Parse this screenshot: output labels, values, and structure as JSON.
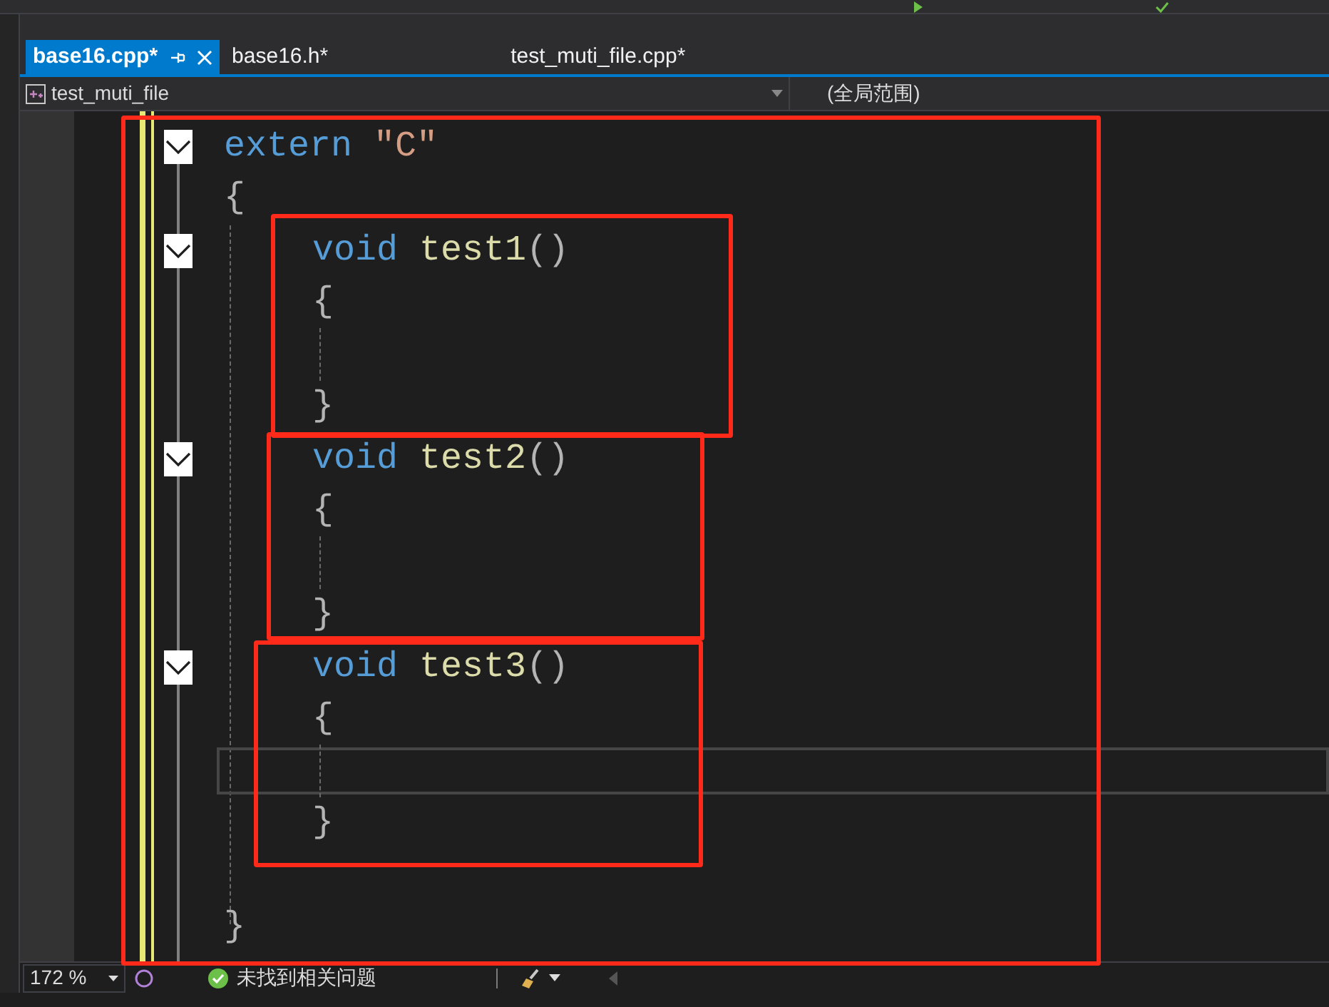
{
  "tabs": [
    {
      "label": "base16.cpp*",
      "selected": true,
      "pinned": true
    },
    {
      "label": "base16.h*",
      "selected": false,
      "pinned": false
    },
    {
      "label": "test_muti_file.cpp*",
      "selected": false,
      "pinned": false
    }
  ],
  "nav_bar": {
    "scope": "test_muti_file",
    "member": "(全局范围)"
  },
  "code_lines": [
    {
      "indented": false,
      "foldable": true,
      "current": false,
      "tokens": [
        {
          "kind": "keyword",
          "text": "extern"
        },
        {
          "kind": "string",
          "text": "\"C\""
        }
      ]
    },
    {
      "indented": false,
      "foldable": false,
      "current": false,
      "tokens": [
        {
          "kind": "punct",
          "text": "{"
        }
      ]
    },
    {
      "indented": true,
      "foldable": true,
      "current": false,
      "tokens": [
        {
          "kind": "keyword",
          "text": "void"
        },
        {
          "kind": "function",
          "text": "test1"
        },
        {
          "kind": "punct",
          "text": "()"
        }
      ]
    },
    {
      "indented": true,
      "foldable": false,
      "current": false,
      "tokens": [
        {
          "kind": "punct",
          "text": "{"
        }
      ]
    },
    {
      "indented": true,
      "foldable": false,
      "current": false
    },
    {
      "indented": true,
      "foldable": false,
      "current": false,
      "tokens": [
        {
          "kind": "punct",
          "text": "}"
        }
      ]
    },
    {
      "indented": true,
      "foldable": true,
      "current": false,
      "tokens": [
        {
          "kind": "keyword",
          "text": "void"
        },
        {
          "kind": "function",
          "text": "test2"
        },
        {
          "kind": "punct",
          "text": "()"
        }
      ]
    },
    {
      "indented": true,
      "foldable": false,
      "current": false,
      "tokens": [
        {
          "kind": "punct",
          "text": "{"
        }
      ]
    },
    {
      "indented": true,
      "foldable": false,
      "current": false
    },
    {
      "indented": true,
      "foldable": false,
      "current": false,
      "tokens": [
        {
          "kind": "punct",
          "text": "}"
        }
      ]
    },
    {
      "indented": true,
      "foldable": true,
      "current": false,
      "tokens": [
        {
          "kind": "keyword",
          "text": "void"
        },
        {
          "kind": "function",
          "text": "test3"
        },
        {
          "kind": "punct",
          "text": "()"
        }
      ]
    },
    {
      "indented": true,
      "foldable": false,
      "current": false,
      "tokens": [
        {
          "kind": "punct",
          "text": "{"
        }
      ]
    },
    {
      "indented": true,
      "foldable": false,
      "current": true
    },
    {
      "indented": true,
      "foldable": false,
      "current": false,
      "tokens": [
        {
          "kind": "punct",
          "text": "}"
        }
      ]
    },
    {
      "indented": false,
      "foldable": false,
      "current": false
    },
    {
      "indented": false,
      "foldable": false,
      "current": false,
      "tokens": [
        {
          "kind": "punct",
          "text": "}"
        }
      ]
    }
  ],
  "status_bar": {
    "zoom": "172 %",
    "issues": "未找到相关问题"
  }
}
